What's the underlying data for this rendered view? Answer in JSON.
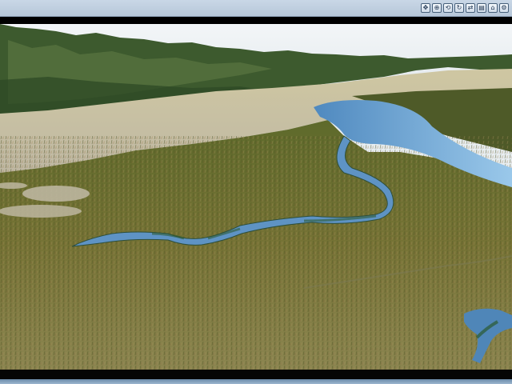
{
  "window": {
    "title": "",
    "status": ""
  },
  "toolbar": {
    "buttons": [
      {
        "icon": "move-icon",
        "glyph": "✥"
      },
      {
        "icon": "zoom-icon",
        "glyph": "⊕"
      },
      {
        "icon": "tilt-icon",
        "glyph": "⟲"
      },
      {
        "icon": "rotate-icon",
        "glyph": "↻"
      },
      {
        "icon": "pan-icon",
        "glyph": "⇄"
      },
      {
        "icon": "layers-icon",
        "glyph": "▤"
      },
      {
        "icon": "reset-icon",
        "glyph": "⌂"
      },
      {
        "icon": "settings-icon",
        "glyph": "⚙"
      }
    ]
  },
  "scene": {
    "sky_color": "#eef2f4",
    "mountain_color": "#3f5a32",
    "plain_color": "#d8cfae",
    "marsh_color": "#6a6d33",
    "water_color": "#6fa6d6"
  }
}
